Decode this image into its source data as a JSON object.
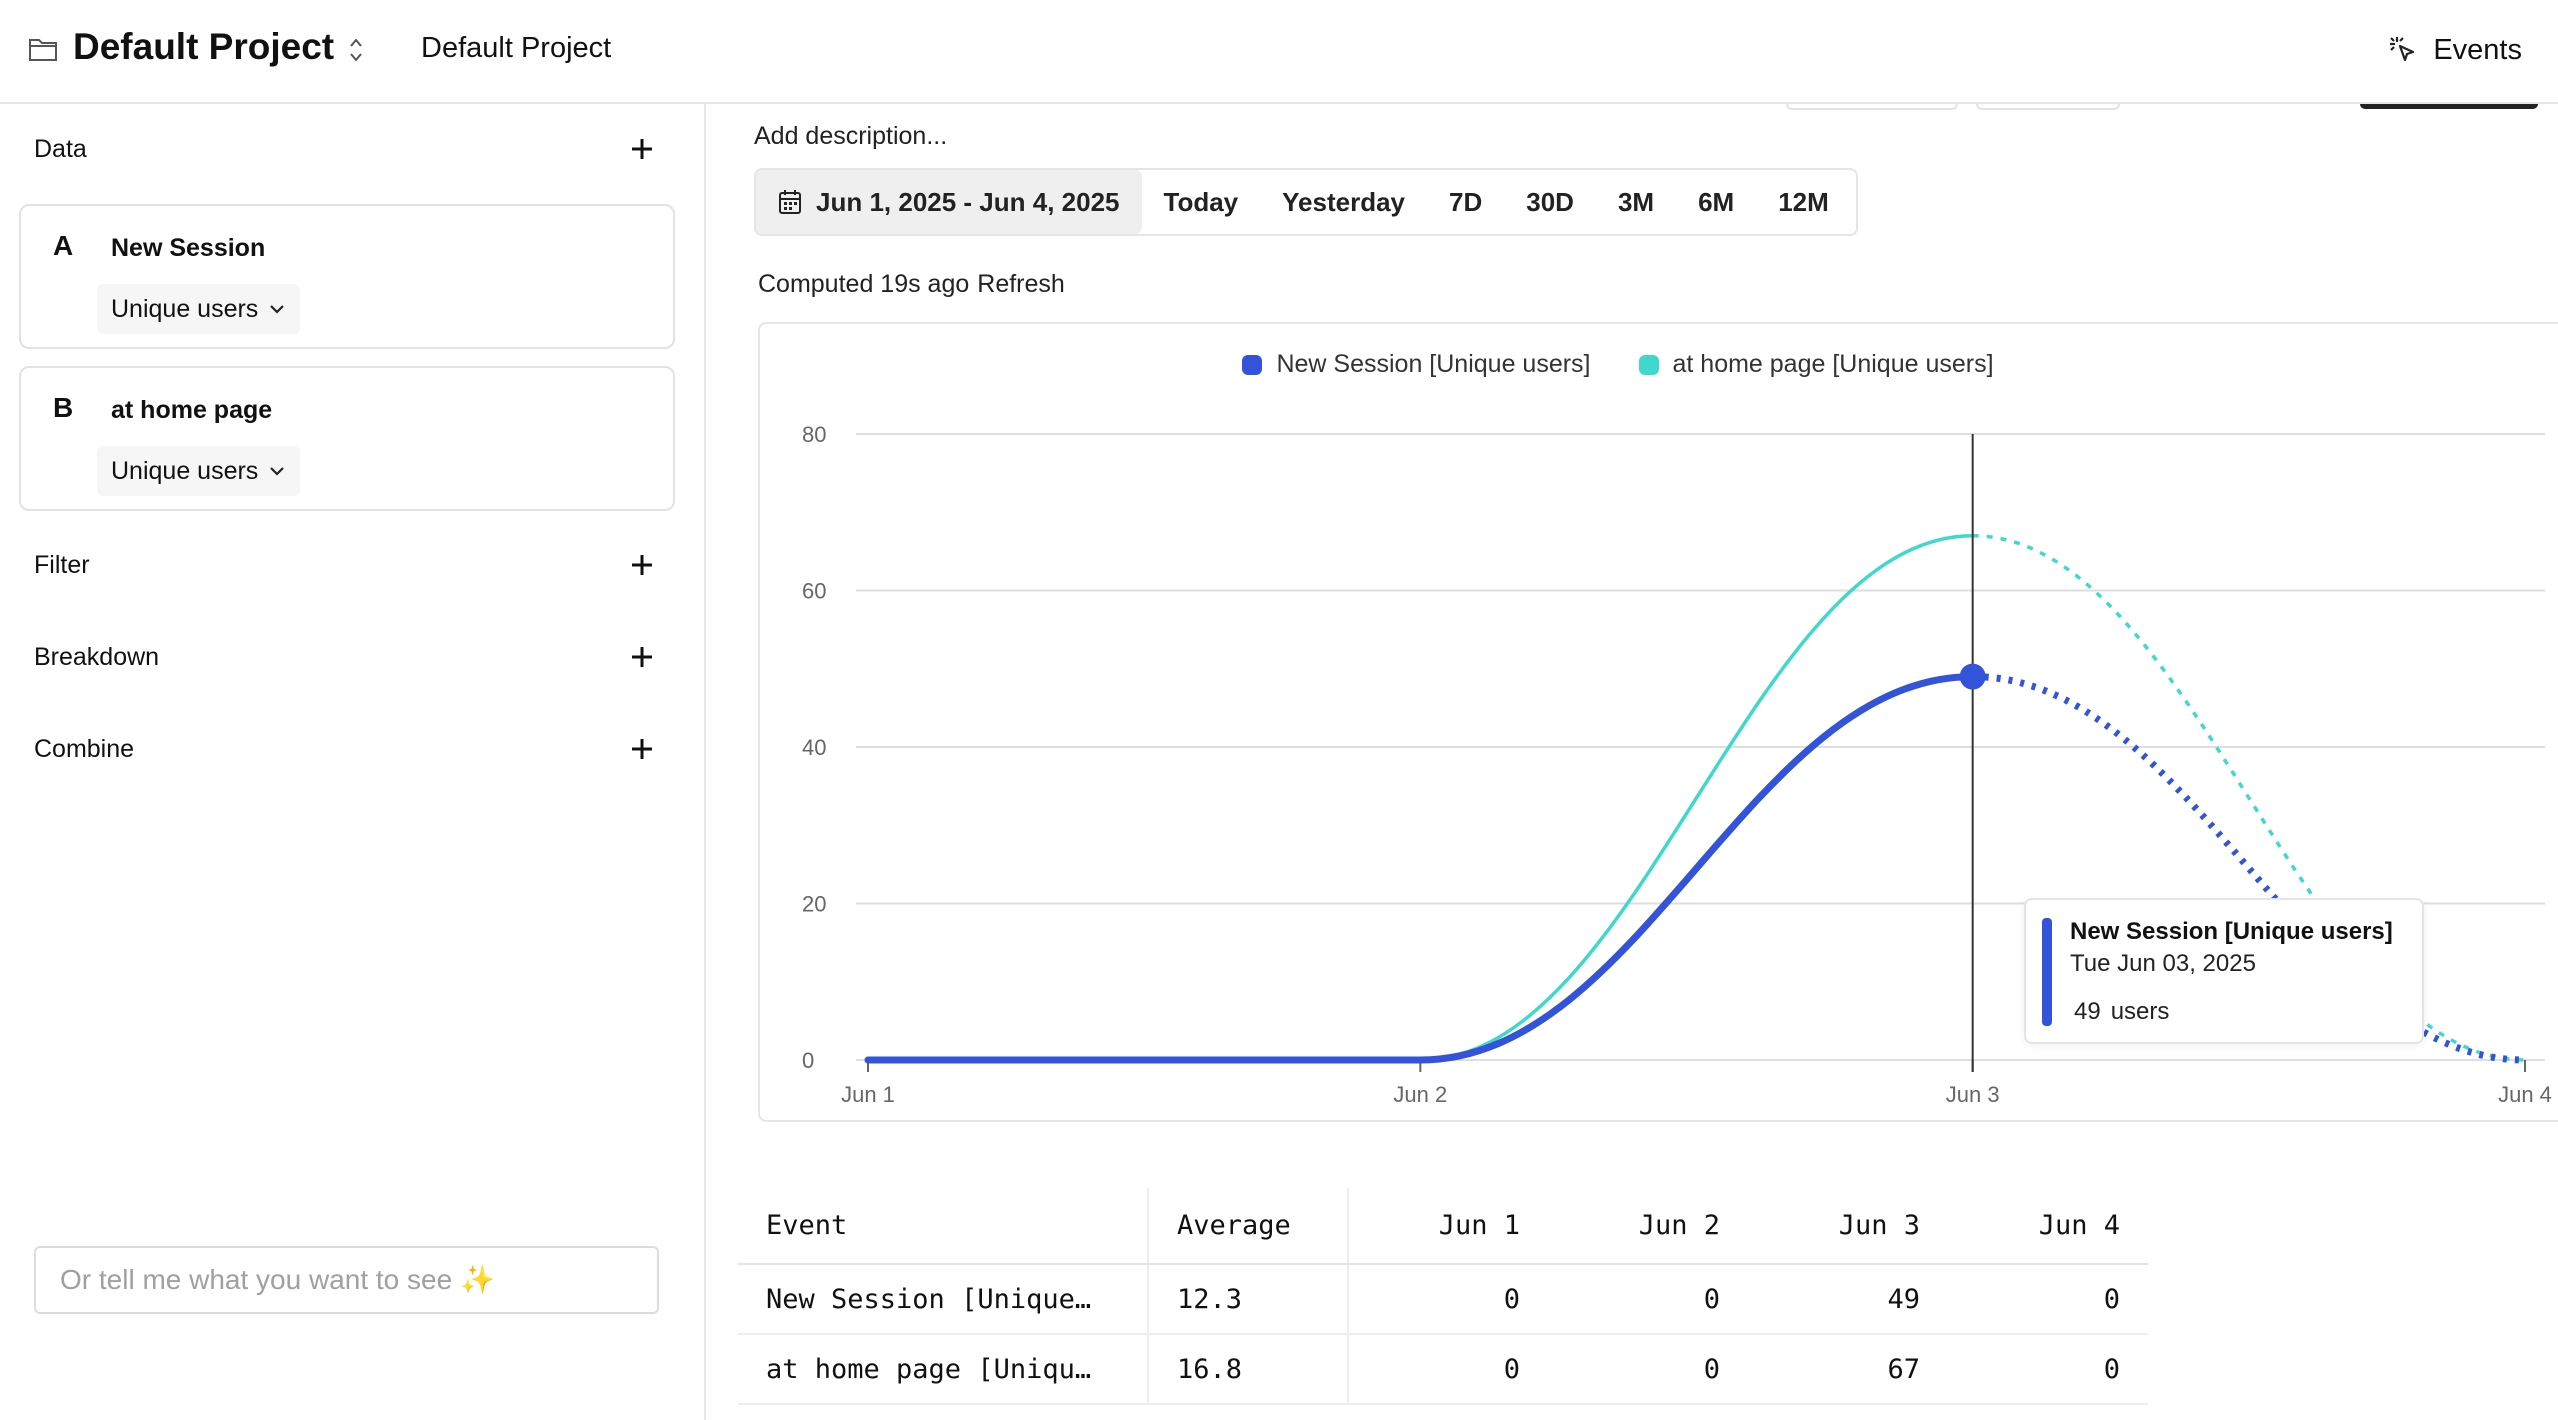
{
  "header": {
    "project_title": "Default Project",
    "project_crumb": "Default Project",
    "events_label": "Events"
  },
  "sidebar": {
    "data_label": "Data",
    "events": [
      {
        "letter": "A",
        "name": "New Session",
        "metric": "Unique users"
      },
      {
        "letter": "B",
        "name": "at home page",
        "metric": "Unique users"
      }
    ],
    "filter_label": "Filter",
    "breakdown_label": "Breakdown",
    "combine_label": "Combine",
    "ask_placeholder": "Or tell me what you want to see ✨"
  },
  "main": {
    "add_description": "Add description...",
    "date_range": "Jun 1, 2025 - Jun 4, 2025",
    "range_options": [
      "Today",
      "Yesterday",
      "7D",
      "30D",
      "3M",
      "6M",
      "12M"
    ],
    "computed_text": "Computed 19s ago",
    "refresh_label": "Refresh"
  },
  "chart_data": {
    "type": "line",
    "x": [
      "Jun 1",
      "Jun 2",
      "Jun 3",
      "Jun 4"
    ],
    "series": [
      {
        "name": "New Session [Unique users]",
        "values": [
          0,
          0,
          49,
          0
        ],
        "color": "#3354d8"
      },
      {
        "name": "at home page [Unique users]",
        "values": [
          0,
          0,
          67,
          0
        ],
        "color": "#3fd8cc"
      }
    ],
    "ylim": [
      0,
      80
    ],
    "yticks": [
      0,
      20,
      40,
      60,
      80
    ],
    "grid": true,
    "legend": "top-center",
    "last_segment_style": "dotted",
    "hover_index": 2
  },
  "tooltip": {
    "series": "New Session [Unique users]",
    "date": "Tue Jun 03, 2025",
    "value": "49",
    "unit": "users"
  },
  "table": {
    "headers": [
      "Event",
      "Average",
      "Jun 1",
      "Jun 2",
      "Jun 3",
      "Jun 4"
    ],
    "rows": [
      [
        "New Session [Unique…",
        "12.3",
        "0",
        "0",
        "49",
        "0"
      ],
      [
        "at home page [Uniqu…",
        "16.8",
        "0",
        "0",
        "67",
        "0"
      ]
    ]
  }
}
